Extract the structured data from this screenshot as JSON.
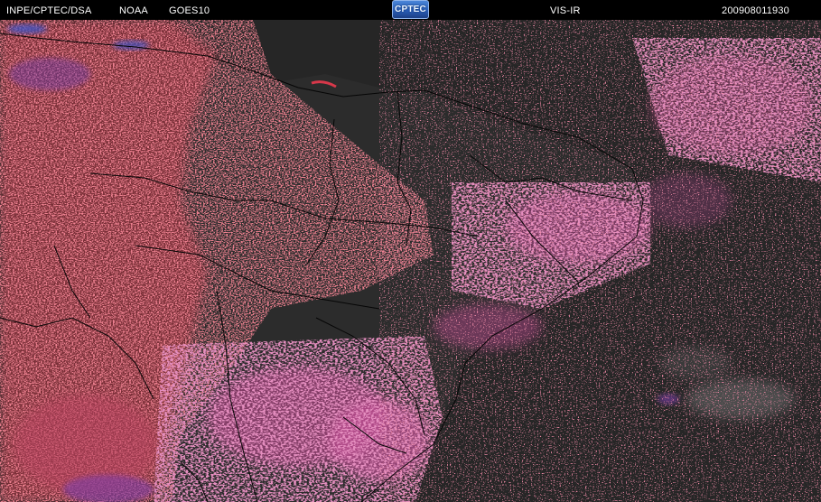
{
  "header": {
    "source": "INPE/CPTEC/DSA",
    "agency": "NOAA",
    "satellite": "GOES10",
    "logo": "CPTEC",
    "channel": "VIS-IR",
    "timestamp": "200908011930"
  },
  "colors": {
    "background": "#000000",
    "ocean": "#262626",
    "cloud_red": "#d8384a",
    "cloud_magenta": "#c04a8c",
    "cloud_purple": "#7a3ca8",
    "cloud_grey": "#8a8a8a",
    "border_lines": "#050505"
  }
}
